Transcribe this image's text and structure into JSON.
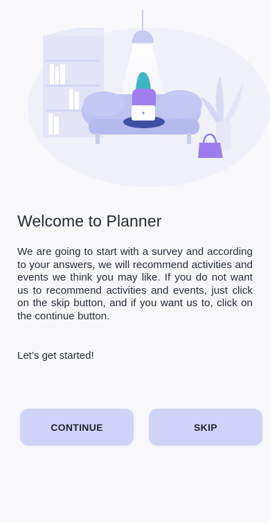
{
  "intro": {
    "title": "Welcome to Planner",
    "description": "We are going to start with a survey and according to your answers, we will recommend activities and events we think you may like. If you do not want us to recommend activities and events, just click on the skip button, and if you want us to, click on the continue button.",
    "started": "Let’s get started!"
  },
  "actions": {
    "continue_label": "CONTINUE",
    "skip_label": "SKIP"
  },
  "colors": {
    "background": "#f8f8fb",
    "button": "#cfd3f7",
    "accent": "#8c7ff0"
  },
  "illustration": {
    "icon": "person-on-couch-with-laptop-illustration"
  }
}
